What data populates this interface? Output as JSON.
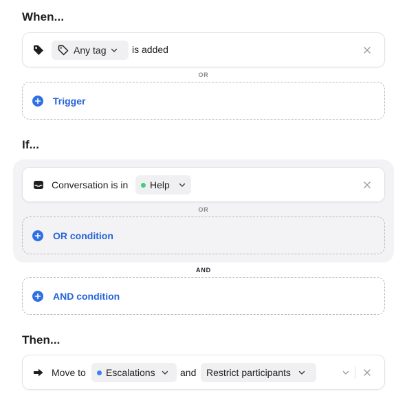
{
  "when": {
    "heading": "When...",
    "trigger": {
      "tag_select": "Any tag",
      "suffix": "is added"
    },
    "or_label": "OR",
    "add_trigger": "Trigger"
  },
  "if": {
    "heading": "If...",
    "condition": {
      "prefix": "Conversation is in",
      "inbox_select": "Help",
      "inbox_dot_color": "#3fcf7a"
    },
    "or_label": "OR",
    "add_or": "OR condition",
    "and_label": "AND",
    "add_and": "AND condition"
  },
  "then": {
    "heading": "Then...",
    "action": {
      "prefix": "Move to",
      "target_select": "Escalations",
      "target_dot_color": "#3b82f6",
      "joiner": "and",
      "option_select": "Restrict participants"
    }
  },
  "colors": {
    "accent": "#2563d8",
    "plus_bg": "#2f6fe4"
  }
}
